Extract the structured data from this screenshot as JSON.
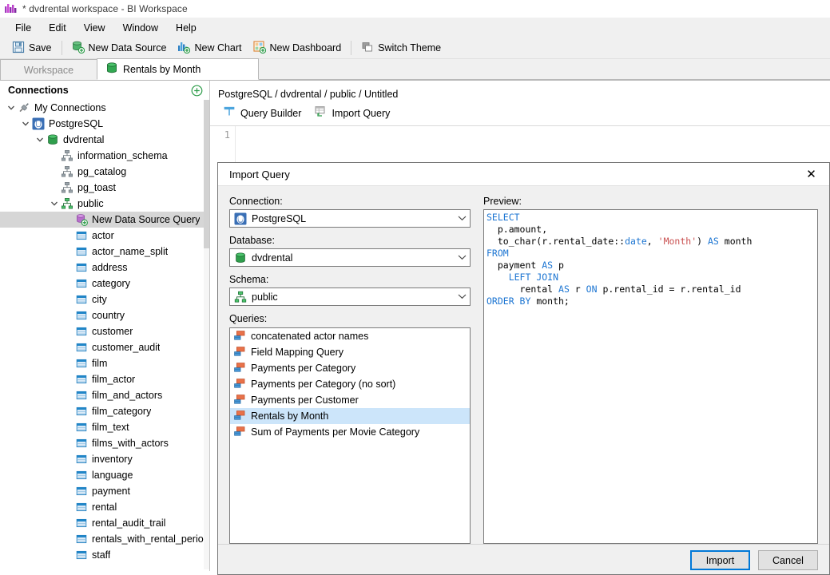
{
  "window": {
    "title": "* dvdrental workspace - BI Workspace",
    "app_icon": "bar-chart-icon"
  },
  "menubar": {
    "items": [
      "File",
      "Edit",
      "View",
      "Window",
      "Help"
    ]
  },
  "toolbar": {
    "buttons": [
      {
        "label": "Save",
        "icon": "save-icon"
      },
      {
        "label": "New Data Source",
        "icon": "new-data-source-icon"
      },
      {
        "label": "New Chart",
        "icon": "new-chart-icon"
      },
      {
        "label": "New Dashboard",
        "icon": "new-dashboard-icon"
      },
      {
        "label": "Switch Theme",
        "icon": "switch-theme-icon"
      }
    ]
  },
  "tabs": [
    {
      "label": "Workspace",
      "active": false
    },
    {
      "label": "Rentals by Month",
      "active": true,
      "icon": "database-icon"
    }
  ],
  "sidebar": {
    "header": "Connections",
    "add_icon": "plus-circle-icon",
    "tree": [
      {
        "label": "My Connections",
        "indent": 0,
        "icon": "plug-icon",
        "chevron": "down",
        "selected": false
      },
      {
        "label": "PostgreSQL",
        "indent": 1,
        "icon": "postgres-icon",
        "chevron": "down",
        "selected": false
      },
      {
        "label": "dvdrental",
        "indent": 2,
        "icon": "database-icon",
        "chevron": "down",
        "selected": false
      },
      {
        "label": "information_schema",
        "indent": 3,
        "icon": "schema-icon",
        "chevron": "none",
        "selected": false
      },
      {
        "label": "pg_catalog",
        "indent": 3,
        "icon": "schema-icon",
        "chevron": "none",
        "selected": false
      },
      {
        "label": "pg_toast",
        "indent": 3,
        "icon": "schema-icon",
        "chevron": "none",
        "selected": false
      },
      {
        "label": "public",
        "indent": 3,
        "icon": "schema-green-icon",
        "chevron": "down",
        "selected": false
      },
      {
        "label": "New Data Source Query",
        "indent": 4,
        "icon": "new-query-icon",
        "chevron": "none",
        "selected": true
      },
      {
        "label": "actor",
        "indent": 4,
        "icon": "table-icon",
        "chevron": "none",
        "selected": false
      },
      {
        "label": "actor_name_split",
        "indent": 4,
        "icon": "table-icon",
        "chevron": "none",
        "selected": false
      },
      {
        "label": "address",
        "indent": 4,
        "icon": "table-icon",
        "chevron": "none",
        "selected": false
      },
      {
        "label": "category",
        "indent": 4,
        "icon": "table-icon",
        "chevron": "none",
        "selected": false
      },
      {
        "label": "city",
        "indent": 4,
        "icon": "table-icon",
        "chevron": "none",
        "selected": false
      },
      {
        "label": "country",
        "indent": 4,
        "icon": "table-icon",
        "chevron": "none",
        "selected": false
      },
      {
        "label": "customer",
        "indent": 4,
        "icon": "table-icon",
        "chevron": "none",
        "selected": false
      },
      {
        "label": "customer_audit",
        "indent": 4,
        "icon": "table-icon",
        "chevron": "none",
        "selected": false
      },
      {
        "label": "film",
        "indent": 4,
        "icon": "table-icon",
        "chevron": "none",
        "selected": false
      },
      {
        "label": "film_actor",
        "indent": 4,
        "icon": "table-icon",
        "chevron": "none",
        "selected": false
      },
      {
        "label": "film_and_actors",
        "indent": 4,
        "icon": "table-icon",
        "chevron": "none",
        "selected": false
      },
      {
        "label": "film_category",
        "indent": 4,
        "icon": "table-icon",
        "chevron": "none",
        "selected": false
      },
      {
        "label": "film_text",
        "indent": 4,
        "icon": "table-icon",
        "chevron": "none",
        "selected": false
      },
      {
        "label": "films_with_actors",
        "indent": 4,
        "icon": "table-icon",
        "chevron": "none",
        "selected": false
      },
      {
        "label": "inventory",
        "indent": 4,
        "icon": "table-icon",
        "chevron": "none",
        "selected": false
      },
      {
        "label": "language",
        "indent": 4,
        "icon": "table-icon",
        "chevron": "none",
        "selected": false
      },
      {
        "label": "payment",
        "indent": 4,
        "icon": "table-icon",
        "chevron": "none",
        "selected": false
      },
      {
        "label": "rental",
        "indent": 4,
        "icon": "table-icon",
        "chevron": "none",
        "selected": false
      },
      {
        "label": "rental_audit_trail",
        "indent": 4,
        "icon": "table-icon",
        "chevron": "none",
        "selected": false
      },
      {
        "label": "rentals_with_rental_period",
        "indent": 4,
        "icon": "table-icon",
        "chevron": "none",
        "selected": false
      },
      {
        "label": "staff",
        "indent": 4,
        "icon": "table-icon",
        "chevron": "none",
        "selected": false
      }
    ]
  },
  "editor": {
    "breadcrumb": "PostgreSQL / dvdrental / public / Untitled",
    "actions": [
      {
        "label": "Query Builder",
        "icon": "query-builder-icon"
      },
      {
        "label": "Import Query",
        "icon": "import-query-icon"
      }
    ],
    "line_number": "1"
  },
  "dialog": {
    "title": "Import Query",
    "close_icon": "close-icon",
    "connection_label": "Connection:",
    "connection_value": "PostgreSQL",
    "connection_icon": "postgres-icon",
    "database_label": "Database:",
    "database_value": "dvdrental",
    "database_icon": "database-icon",
    "schema_label": "Schema:",
    "schema_value": "public",
    "schema_icon": "schema-green-icon",
    "queries_label": "Queries:",
    "queries": [
      {
        "label": "concatenated actor names",
        "selected": false
      },
      {
        "label": "Field Mapping Query",
        "selected": false
      },
      {
        "label": "Payments per Category",
        "selected": false
      },
      {
        "label": "Payments per Category (no sort)",
        "selected": false
      },
      {
        "label": "Payments per Customer",
        "selected": false
      },
      {
        "label": "Rentals by Month",
        "selected": true
      },
      {
        "label": "Sum of Payments per Movie Category",
        "selected": false
      }
    ],
    "preview_label": "Preview:",
    "preview_sql_lines": [
      [
        {
          "t": "SELECT",
          "c": "kw"
        }
      ],
      [
        {
          "t": "  p.amount,",
          "c": ""
        }
      ],
      [
        {
          "t": "  to_char(r.rental_date::",
          "c": ""
        },
        {
          "t": "date",
          "c": "typ"
        },
        {
          "t": ", ",
          "c": ""
        },
        {
          "t": "'Month'",
          "c": "str"
        },
        {
          "t": ") ",
          "c": ""
        },
        {
          "t": "AS",
          "c": "kw"
        },
        {
          "t": " month",
          "c": ""
        }
      ],
      [
        {
          "t": "FROM",
          "c": "kw"
        }
      ],
      [
        {
          "t": "  payment ",
          "c": ""
        },
        {
          "t": "AS",
          "c": "kw"
        },
        {
          "t": " p",
          "c": ""
        }
      ],
      [
        {
          "t": "    ",
          "c": ""
        },
        {
          "t": "LEFT JOIN",
          "c": "kw"
        }
      ],
      [
        {
          "t": "      rental ",
          "c": ""
        },
        {
          "t": "AS",
          "c": "kw"
        },
        {
          "t": " r ",
          "c": ""
        },
        {
          "t": "ON",
          "c": "kw"
        },
        {
          "t": " p.rental_id = r.rental_id",
          "c": ""
        }
      ],
      [
        {
          "t": "ORDER BY",
          "c": "kw"
        },
        {
          "t": " month;",
          "c": ""
        }
      ]
    ],
    "import_button": "Import",
    "cancel_button": "Cancel"
  },
  "colors": {
    "accent_blue": "#0078d7",
    "selection_blue": "#cce5fa",
    "selection_grey": "#d6d6d6",
    "sql_keyword": "#1c75d2",
    "sql_string": "#c94f4f",
    "window_bg": "#f0f0f0"
  }
}
